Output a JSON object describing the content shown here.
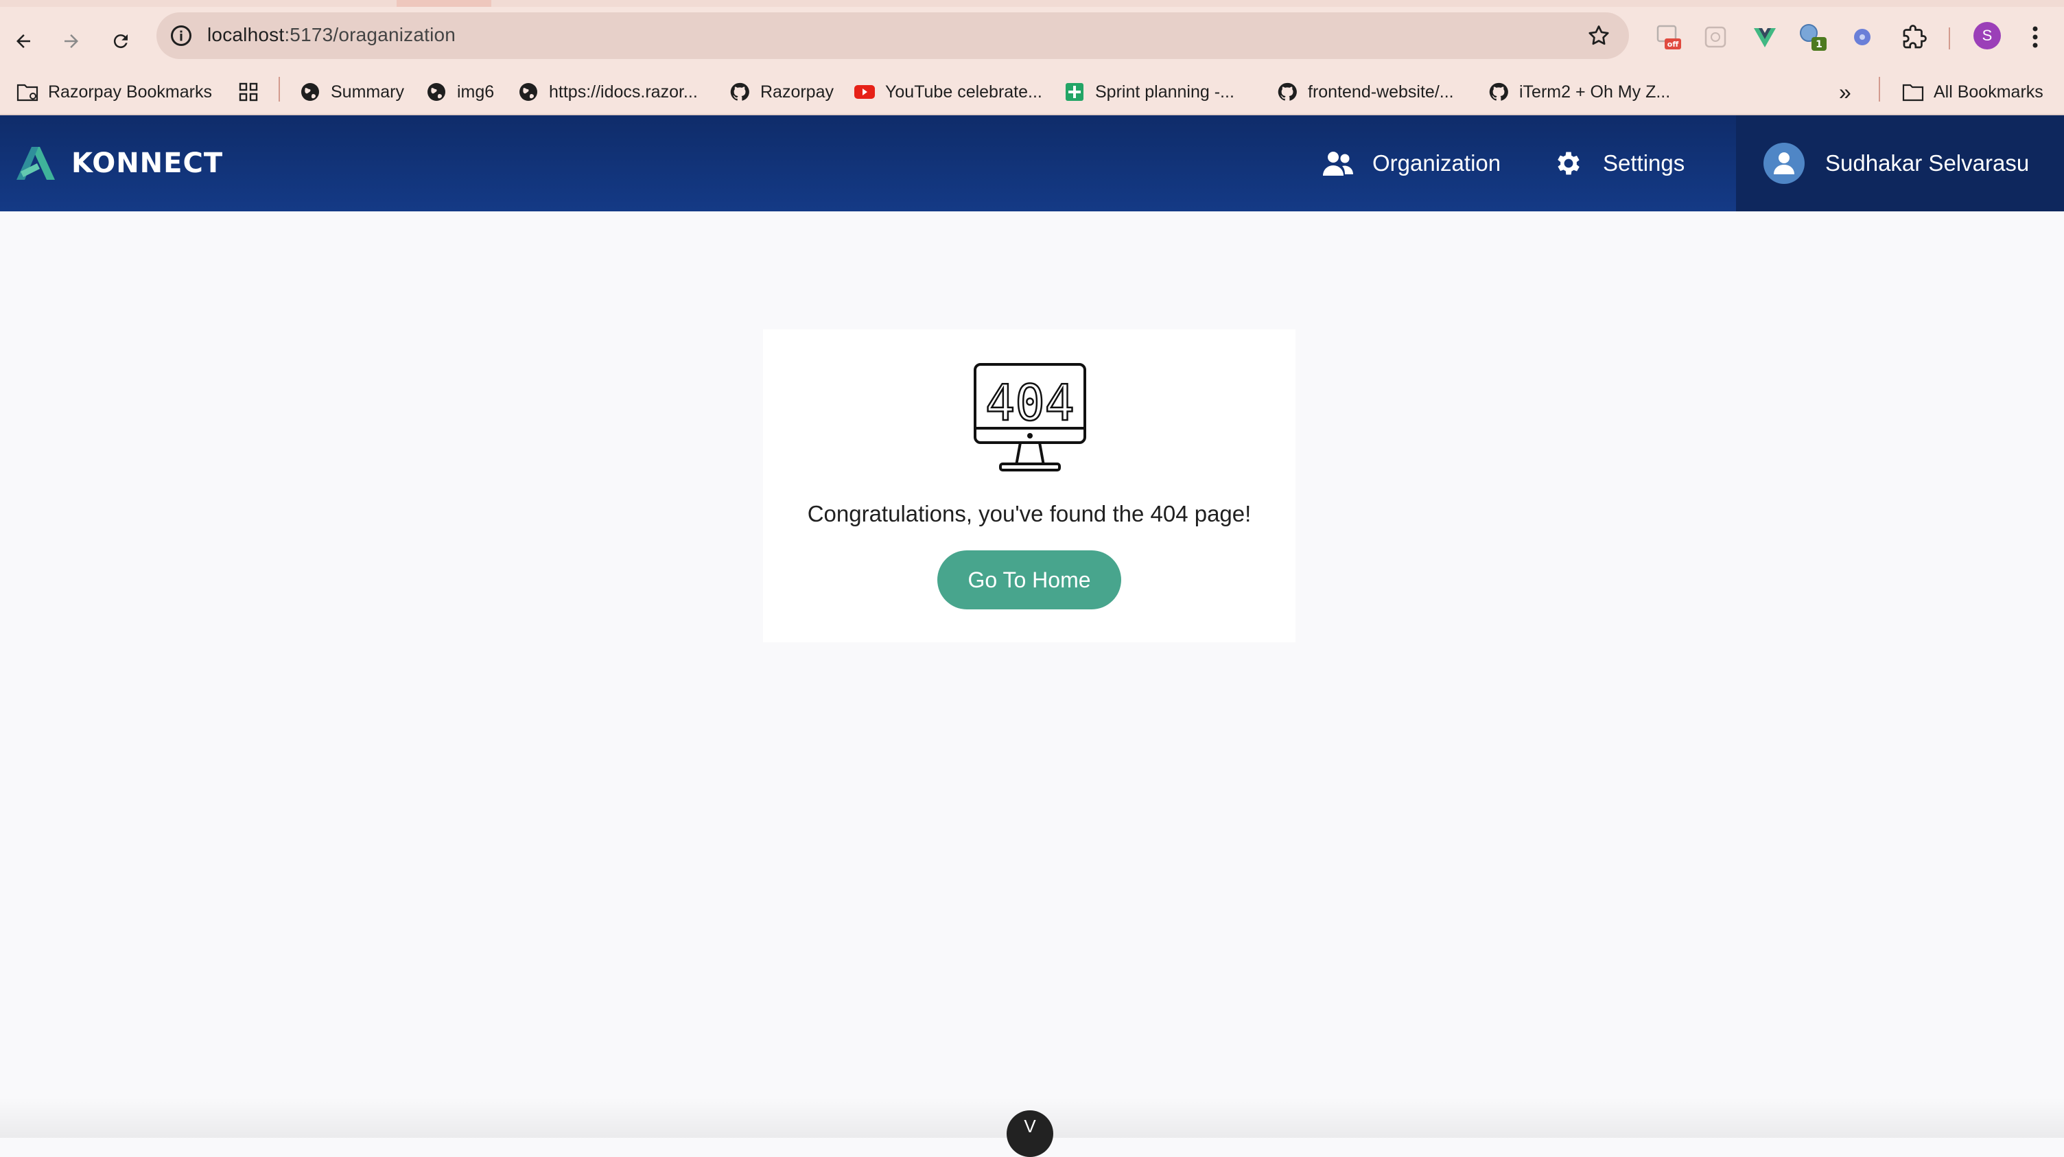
{
  "browser": {
    "url_host": "localhost",
    "url_path": ":5173/oraganization",
    "bookmarks": [
      {
        "label": "Razorpay Bookmarks",
        "icon": "folder-icon"
      },
      {
        "label": "",
        "icon": "apps-grid-icon"
      },
      {
        "label": "Summary",
        "icon": "globe-icon"
      },
      {
        "label": "img6",
        "icon": "globe-icon"
      },
      {
        "label": "https://idocs.razor...",
        "icon": "globe-icon"
      },
      {
        "label": "Razorpay",
        "icon": "github-icon"
      },
      {
        "label": "YouTube celebrate...",
        "icon": "youtube-icon"
      },
      {
        "label": "Sprint planning -...",
        "icon": "sheets-icon"
      },
      {
        "label": "frontend-website/...",
        "icon": "github-icon"
      },
      {
        "label": "iTerm2 + Oh My Z...",
        "icon": "github-icon"
      }
    ],
    "all_bookmarks": "All Bookmarks",
    "more_bookmarks": "»",
    "extensions": [
      {
        "icon": "extension-off-icon",
        "badge": "off",
        "badge_color": "#e04a3f"
      },
      {
        "icon": "extension-grid-icon",
        "badge": ""
      },
      {
        "icon": "vue-devtools-icon",
        "badge": ""
      },
      {
        "icon": "extension-globe-icon",
        "badge": "1",
        "badge_color": "#4d7a1f"
      },
      {
        "icon": "react-devtools-icon",
        "badge": ""
      },
      {
        "icon": "puzzle-icon",
        "badge": ""
      }
    ],
    "profile_initial": "S"
  },
  "app": {
    "brand": "KONNECT",
    "nav": {
      "organization": "Organization",
      "settings": "Settings"
    },
    "user_name": "Sudhakar Selvarasu"
  },
  "not_found": {
    "illustration_text": "404",
    "message": "Congratulations, you've found the 404 page!",
    "button_label": "Go To Home"
  },
  "floating_badge": "V",
  "colors": {
    "header_bg": "#12347a",
    "accent_green": "#48a58d",
    "page_bg": "#f9f9fb"
  }
}
